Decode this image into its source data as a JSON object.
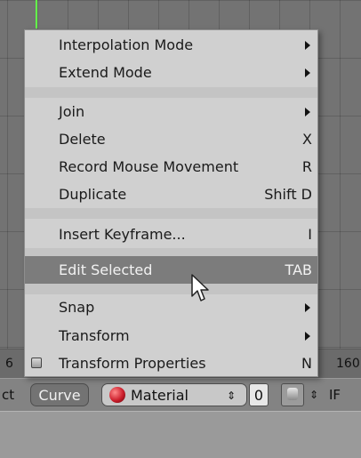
{
  "menu": {
    "items": [
      {
        "label": "Interpolation Mode",
        "shortcut": "",
        "submenu": true
      },
      {
        "label": "Extend Mode",
        "shortcut": "",
        "submenu": true
      },
      {
        "label": "Join",
        "shortcut": "",
        "submenu": true
      },
      {
        "label": "Delete",
        "shortcut": "X",
        "submenu": false
      },
      {
        "label": "Record Mouse Movement",
        "shortcut": "R",
        "submenu": false
      },
      {
        "label": "Duplicate",
        "shortcut": "Shift D",
        "submenu": false
      },
      {
        "label": "Insert Keyframe...",
        "shortcut": "I",
        "submenu": false
      },
      {
        "label": "Edit Selected",
        "shortcut": "TAB",
        "submenu": false,
        "highlighted": true
      },
      {
        "label": "Snap",
        "shortcut": "",
        "submenu": true
      },
      {
        "label": "Transform",
        "shortcut": "",
        "submenu": true
      },
      {
        "label": "Transform Properties",
        "shortcut": "N",
        "submenu": false,
        "checkbox": true
      }
    ]
  },
  "frame_strip": {
    "left_number": "6",
    "right_number": "160"
  },
  "header": {
    "select_partial": "ct",
    "curve_tab": "Curve",
    "material_label": "Material",
    "number_field": "0",
    "ipo_partial": "IF",
    "material_color": "#cc1f2c"
  },
  "colors": {
    "highlight": "#7c7c7c",
    "menu_bg": "#d0d0d0",
    "frame_cursor": "#64ff4a"
  }
}
